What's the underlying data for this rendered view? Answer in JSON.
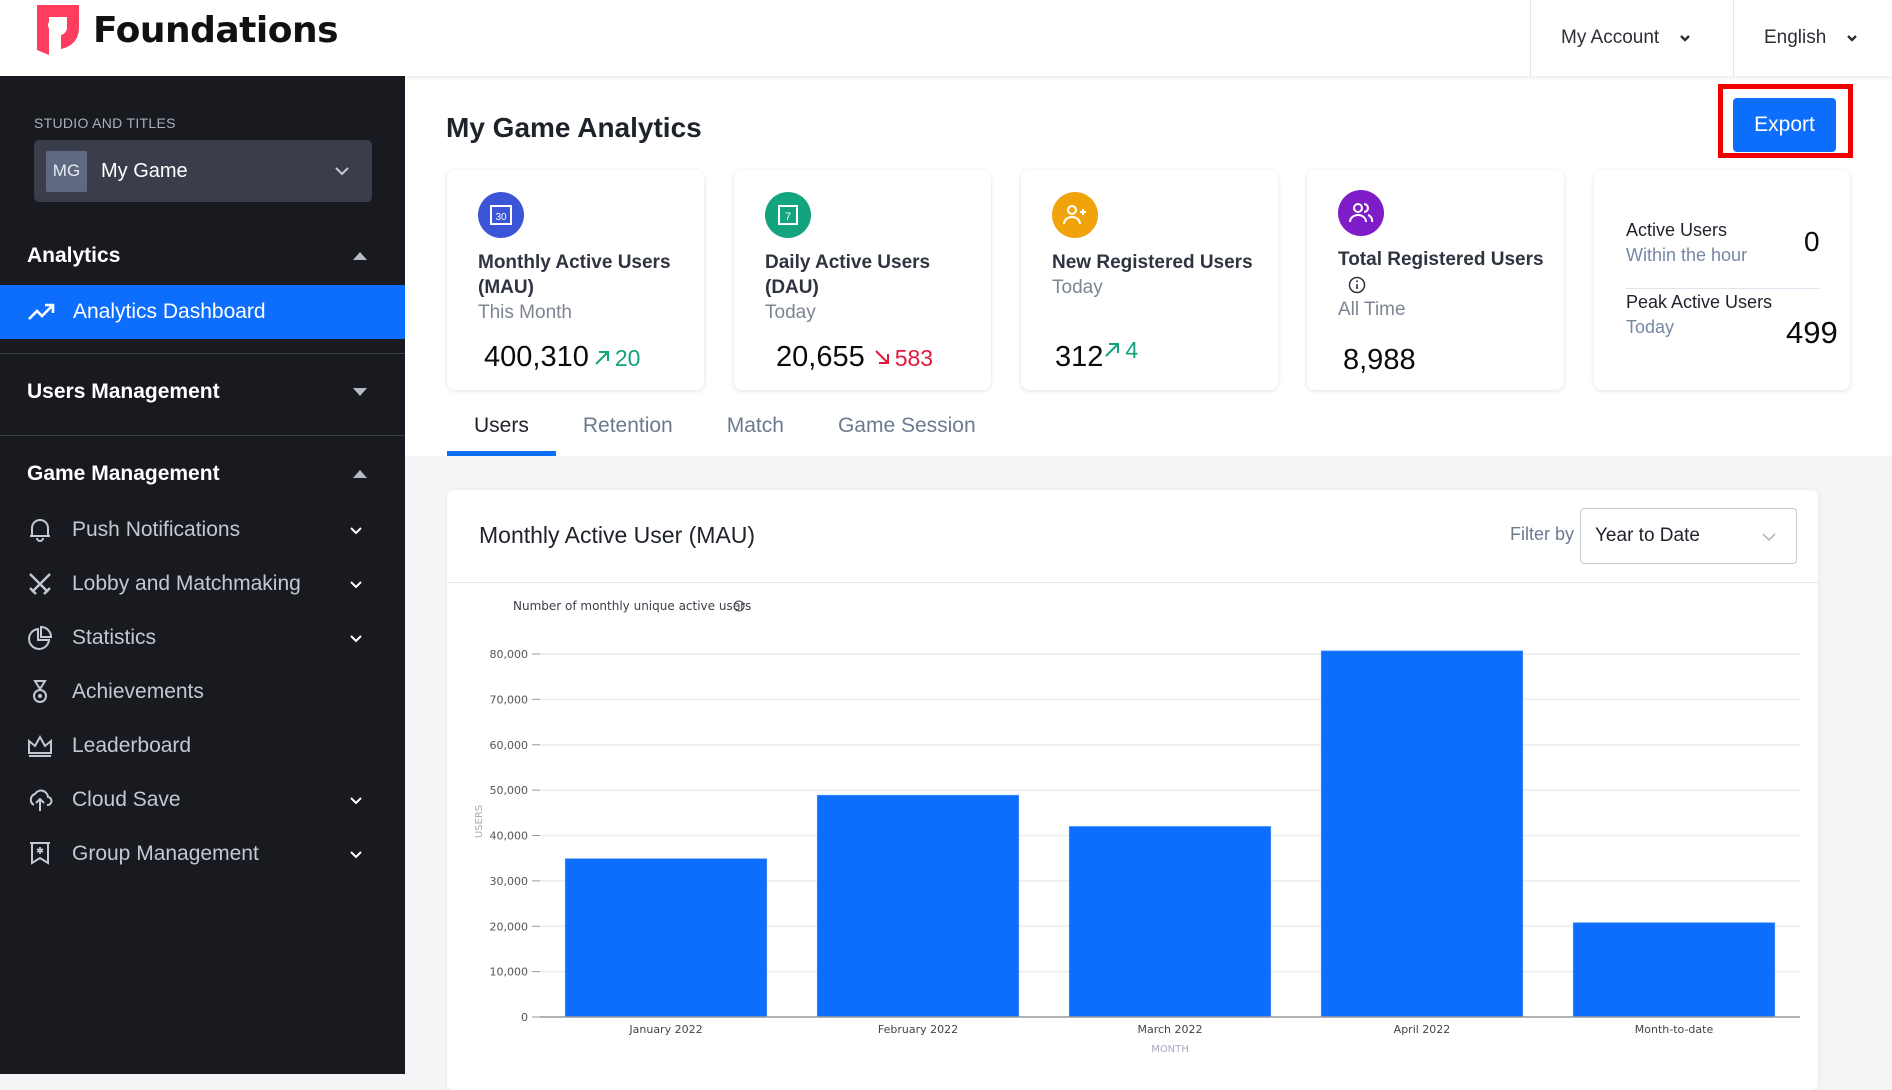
{
  "header": {
    "brand": "Foundations",
    "account_label": "My Account",
    "language_label": "English"
  },
  "sidebar": {
    "studio_label": "STUDIO AND TITLES",
    "game_initials": "MG",
    "game_name": "My Game",
    "sections": [
      {
        "label": "Analytics",
        "expanded": true
      },
      {
        "label": "Users Management",
        "expanded": false
      },
      {
        "label": "Game Management",
        "expanded": true
      }
    ],
    "active_item": {
      "label": "Analytics Dashboard",
      "icon": "trend-up-icon"
    },
    "game_items": [
      {
        "label": "Push Notifications",
        "icon": "bell-icon",
        "has_submenu": true
      },
      {
        "label": "Lobby and Matchmaking",
        "icon": "crossed-swords-icon",
        "has_submenu": true
      },
      {
        "label": "Statistics",
        "icon": "pie-chart-icon",
        "has_submenu": true
      },
      {
        "label": "Achievements",
        "icon": "medal-icon",
        "has_submenu": false
      },
      {
        "label": "Leaderboard",
        "icon": "crown-icon",
        "has_submenu": false
      },
      {
        "label": "Cloud Save",
        "icon": "cloud-upload-icon",
        "has_submenu": true
      },
      {
        "label": "Group Management",
        "icon": "group-banner-icon",
        "has_submenu": true
      }
    ]
  },
  "page": {
    "title": "My Game Analytics",
    "export_label": "Export"
  },
  "colors": {
    "accent": "#0d6efd",
    "sidebar_bg": "#181a1f",
    "up": "#12a37c",
    "down": "#e3183d",
    "highlight_box": "#f00000"
  },
  "cards": [
    {
      "title": "Monthly Active Users (MAU)",
      "subtitle": "This Month",
      "value": "400,310",
      "delta": "20",
      "trend": "up",
      "icon": "calendar-30-icon",
      "icon_color": "#3b55d6",
      "icon_text": "30"
    },
    {
      "title": "Daily Active Users (DAU)",
      "subtitle": "Today",
      "value": "20,655",
      "delta": "583",
      "trend": "down",
      "icon": "calendar-7-icon",
      "icon_color": "#14a37f",
      "icon_text": "7"
    },
    {
      "title": "New Registered Users",
      "subtitle": "Today",
      "value": "312",
      "delta": "4",
      "trend": "up",
      "icon": "user-add-icon",
      "icon_color": "#f0a30a"
    },
    {
      "title": "Total Registered Users",
      "subtitle": "All Time",
      "value": "8,988",
      "icon": "users-icon",
      "icon_color": "#7e1dc8"
    }
  ],
  "active_card": {
    "active_label": "Active Users",
    "active_sub": "Within the hour",
    "active_value": "0",
    "peak_label": "Peak Active Users",
    "peak_sub": "Today",
    "peak_value": "499"
  },
  "tabs": [
    {
      "label": "Users",
      "active": true
    },
    {
      "label": "Retention",
      "active": false
    },
    {
      "label": "Match",
      "active": false
    },
    {
      "label": "Game Session",
      "active": false
    }
  ],
  "chart_panel": {
    "title": "Monthly Active User (MAU)",
    "filter_label": "Filter by",
    "filter_value": "Year to Date"
  },
  "chart_data": {
    "type": "bar",
    "title": "Number of monthly unique active users",
    "xlabel": "MONTH",
    "ylabel": "USERS",
    "categories": [
      "January 2022",
      "February 2022",
      "March 2022",
      "April 2022",
      "Month-to-date"
    ],
    "values": [
      34900,
      48900,
      42000,
      80700,
      20800
    ],
    "ylim": [
      0,
      80000
    ],
    "yticks": [
      0,
      10000,
      20000,
      30000,
      40000,
      50000,
      60000,
      70000,
      80000
    ],
    "ytick_labels": [
      "0",
      "10,000",
      "20,000",
      "30,000",
      "40,000",
      "50,000",
      "60,000",
      "70,000",
      "80,000"
    ],
    "grid": true,
    "bar_color": "#0d6efd",
    "legend": "none"
  }
}
